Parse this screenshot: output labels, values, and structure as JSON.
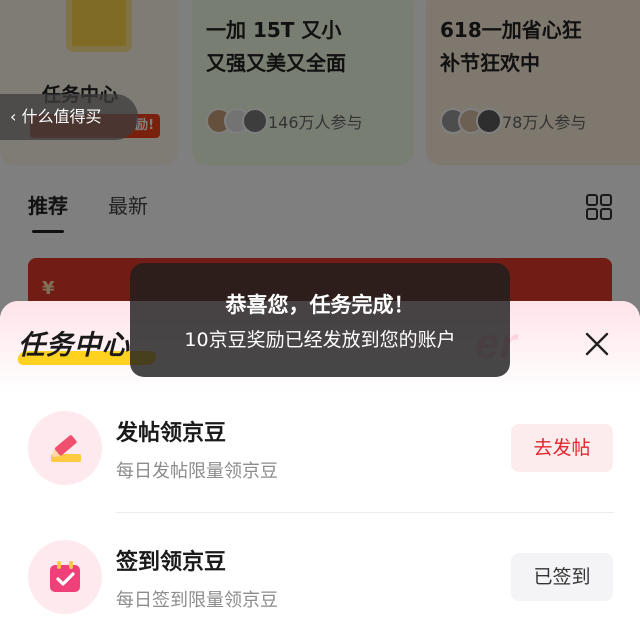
{
  "background": {
    "task_card": {
      "title": "任务中心",
      "badge": "励!"
    },
    "back_button": {
      "label": "什么值得买"
    },
    "cards": [
      {
        "text": "一加 15T 又小\n又强又美又全面",
        "count": "146万人参与"
      },
      {
        "text": "618一加省心狂\n补节狂欢中",
        "count": "78万人参与"
      }
    ],
    "tabs": [
      {
        "label": "推荐",
        "active": true
      },
      {
        "label": "最新",
        "active": false
      }
    ],
    "banner": {
      "symbol": "¥"
    }
  },
  "sheet": {
    "title": "任务中心",
    "watermark": "er",
    "tasks": [
      {
        "title": "发帖领京豆",
        "subtitle": "每日发帖限量领京豆",
        "button": "去发帖",
        "state": "available",
        "icon": "pencil-icon"
      },
      {
        "title": "签到领京豆",
        "subtitle": "每日签到限量领京豆",
        "button": "已签到",
        "state": "completed",
        "icon": "calendar-check-icon"
      }
    ]
  },
  "toast": {
    "title": "恭喜您，任务完成！",
    "message": "10京豆奖励已经发放到您的账户"
  },
  "colors": {
    "accent_red": "#e3262e",
    "highlight_yellow": "#ffd21f",
    "sheet_header_pink": "#ffe3ea"
  }
}
